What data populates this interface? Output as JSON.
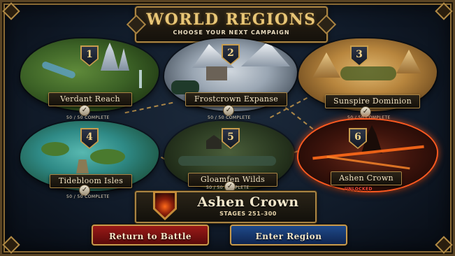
{
  "header": {
    "title": "WORLD REGIONS",
    "subtitle": "CHOOSE YOUR NEXT CAMPAIGN"
  },
  "regions": [
    {
      "number": "1",
      "name": "Verdant Reach",
      "status": "50 / 50 COMPLETE",
      "completed": true,
      "theme": "forest"
    },
    {
      "number": "2",
      "name": "Frostcrown Expanse",
      "status": "50 / 50 COMPLETE",
      "completed": true,
      "theme": "snow"
    },
    {
      "number": "3",
      "name": "Sunspire Dominion",
      "status": "50 / 50 COMPLETE",
      "completed": true,
      "theme": "desert"
    },
    {
      "number": "4",
      "name": "Tidebloom Isles",
      "status": "50 / 50 COMPLETE",
      "completed": true,
      "theme": "tropical"
    },
    {
      "number": "5",
      "name": "Gloamfen Wilds",
      "status": "50 / 50 COMPLETE",
      "completed": true,
      "theme": "swamp"
    },
    {
      "number": "6",
      "name": "Ashen Crown",
      "status": "UNLOCKED",
      "completed": false,
      "theme": "volcanic",
      "selected": true
    }
  ],
  "selected": {
    "name": "Ashen Crown",
    "stages": "STAGES 251–300"
  },
  "buttons": {
    "return_label": "Return to Battle",
    "enter_label": "Enter Region"
  },
  "icons": {
    "check": "check-icon",
    "emblem": "volcano-emblem-icon"
  },
  "colors": {
    "gold": "#c79a4c",
    "return_red": "#9a1a18",
    "enter_blue": "#1f4a8a",
    "unlocked_red": "#ff4a3a"
  }
}
